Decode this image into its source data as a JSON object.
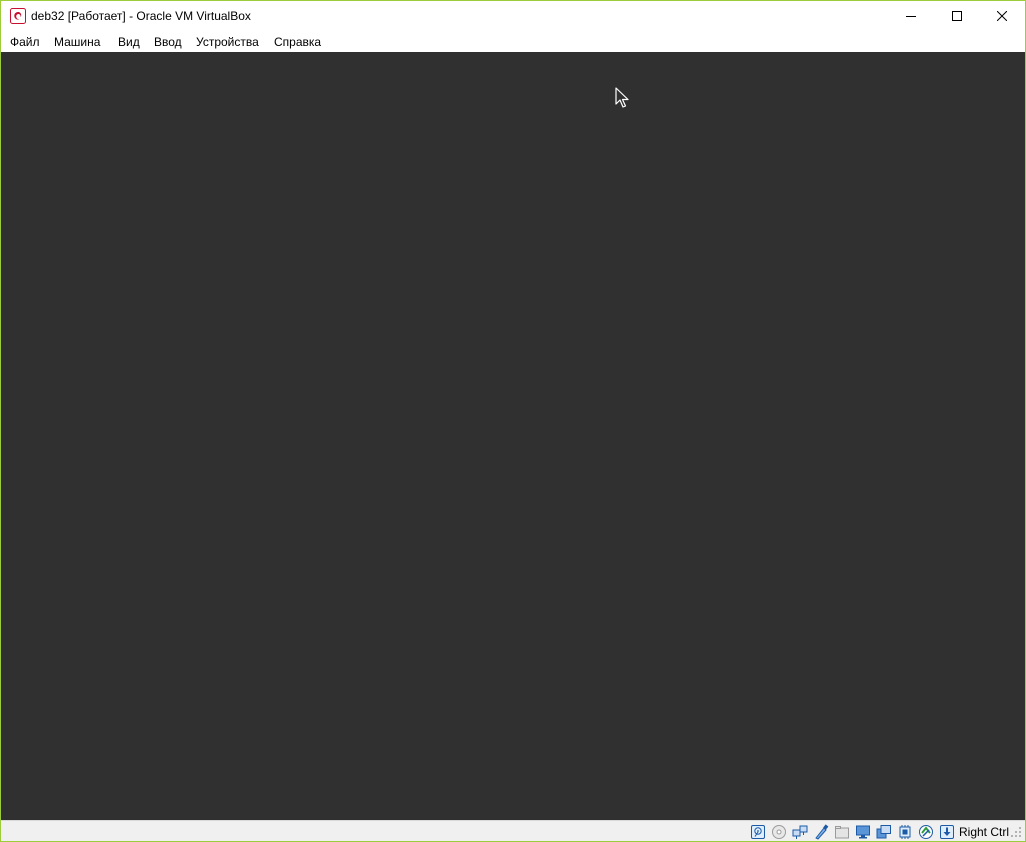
{
  "window": {
    "title": "deb32 [Работает] - Oracle VM VirtualBox",
    "border_color": "#9ccc3a"
  },
  "menubar": {
    "items": [
      "Файл",
      "Машина",
      "Вид",
      "Ввод",
      "Устройства",
      "Справка"
    ]
  },
  "vm_screen": {
    "background": "#303030"
  },
  "statusbar": {
    "icons": [
      "hard-disk-icon",
      "optical-drive-icon",
      "network-icon",
      "usb-icon",
      "shared-folders-icon",
      "display-icon",
      "video-capture-icon",
      "cpu-icon",
      "mouse-integration-icon",
      "keyboard-capture-icon"
    ],
    "host_key": "Right Ctrl"
  }
}
